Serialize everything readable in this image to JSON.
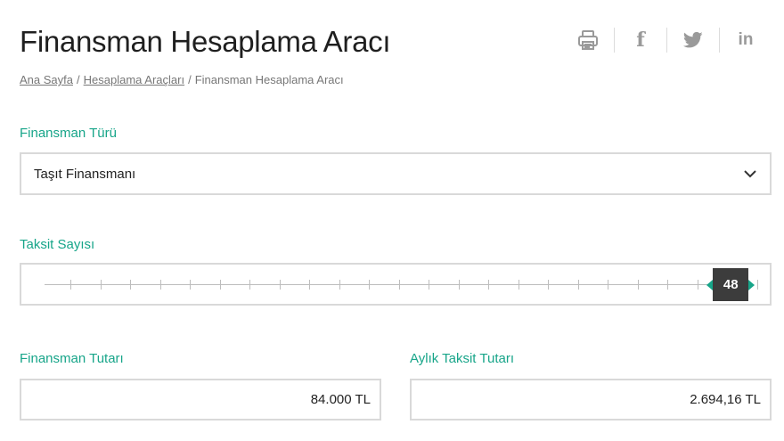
{
  "page": {
    "title": "Finansman Hesaplama Aracı"
  },
  "share": {
    "icons": [
      "print-icon",
      "facebook-icon",
      "twitter-icon",
      "linkedin-icon"
    ],
    "facebook": "f",
    "linkedin": "in"
  },
  "breadcrumb": {
    "items": [
      "Ana Sayfa",
      "Hesaplama Araçları"
    ],
    "current": "Finansman Hesaplama Aracı",
    "separator": "/"
  },
  "finance_type": {
    "label": "Finansman Türü",
    "value": "Taşıt Finansmanı"
  },
  "installments": {
    "label": "Taksit Sayısı",
    "value": "48",
    "position_fraction": 0.975
  },
  "amount": {
    "label": "Finansman Tutarı",
    "value": "84.000 TL"
  },
  "monthly": {
    "label": "Aylık Taksit Tutarı",
    "value": "2.694,16 TL"
  },
  "colors": {
    "accent": "#17a589",
    "border": "#d9d9d9",
    "handle": "#3c3c3c",
    "icon": "#9a9a9a"
  }
}
